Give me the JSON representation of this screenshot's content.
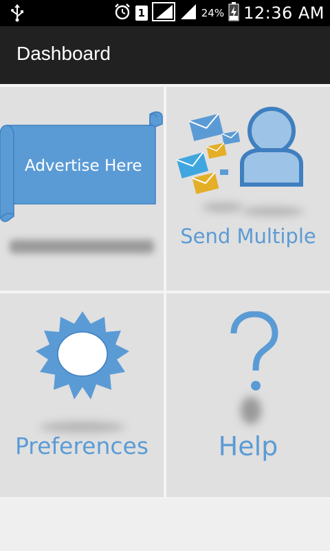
{
  "status_bar": {
    "time": "12:36 AM",
    "battery_percent": "24%",
    "sim_slot": "1",
    "icons": [
      "usb-icon",
      "alarm-icon",
      "sim-icon",
      "signal-icon",
      "signal-icon-2",
      "battery-charging-icon"
    ]
  },
  "action_bar": {
    "title": "Dashboard"
  },
  "tiles": [
    {
      "id": "advertise",
      "label": "Advertise Here",
      "icon": "banner-icon"
    },
    {
      "id": "send-multiple",
      "label": "Send Multiple",
      "icon": "envelopes-person-icon"
    },
    {
      "id": "preferences",
      "label": "Preferences",
      "icon": "badge-icon"
    },
    {
      "id": "help",
      "label": "Help",
      "icon": "question-mark-icon"
    }
  ],
  "colors": {
    "accent": "#5b9bd5",
    "tile_bg": "#e0e0e0",
    "action_bar_bg": "#212121",
    "status_bar_bg": "#000000"
  }
}
